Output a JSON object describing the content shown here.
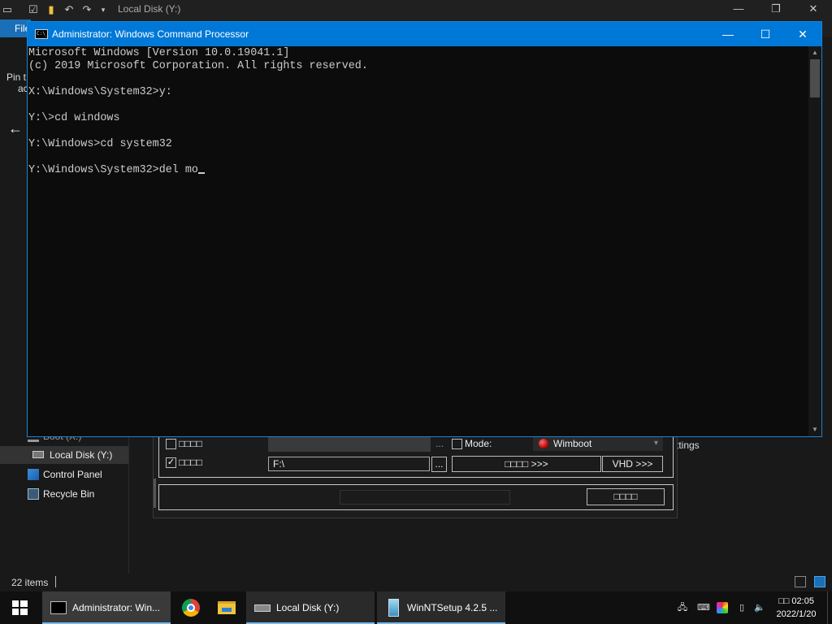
{
  "explorer": {
    "title": "Local Disk (Y:)",
    "file_tab": "File",
    "pin_text": "Pin t",
    "ac_text": "ac",
    "status_count": "22 items",
    "settings_text": "ttings",
    "nav_items": [
      {
        "label": "Boot (X:)"
      },
      {
        "label": "Local Disk (Y:)"
      },
      {
        "label": "Control Panel"
      },
      {
        "label": "Recycle Bin"
      }
    ]
  },
  "winntsetup": {
    "row1_label": "□□□□",
    "row2_label": "□□□□",
    "row2_checked": "✓",
    "path_value": "F:\\",
    "browse1": "...",
    "browse2": "...",
    "mode_label": "Mode:",
    "mode_value": "Wimboot",
    "btn_tweaks": "□□□□ >>>",
    "btn_vhd": "VHD >>>",
    "btn_setup": "□□□□"
  },
  "cmd": {
    "title": "Administrator: Windows Command Processor",
    "lines": [
      "Microsoft Windows [Version 10.0.19041.1]",
      "(c) 2019 Microsoft Corporation. All rights reserved.",
      "",
      "X:\\Windows\\System32>y:",
      "",
      "Y:\\>cd windows",
      "",
      "Y:\\Windows>cd system32",
      "",
      "Y:\\Windows\\System32>del mo"
    ]
  },
  "taskbar": {
    "apps": [
      {
        "label": "Administrator: Win..."
      },
      {
        "label": "Local Disk (Y:)"
      },
      {
        "label": "WinNTSetup 4.2.5   ..."
      }
    ],
    "clock_time": "□□ 02:05",
    "clock_date": "2022/1/20"
  },
  "colors": {
    "accent": "#0078d7",
    "console_bg": "#0c0c0c",
    "console_fg": "#cccccc",
    "taskbar": "#101010"
  }
}
